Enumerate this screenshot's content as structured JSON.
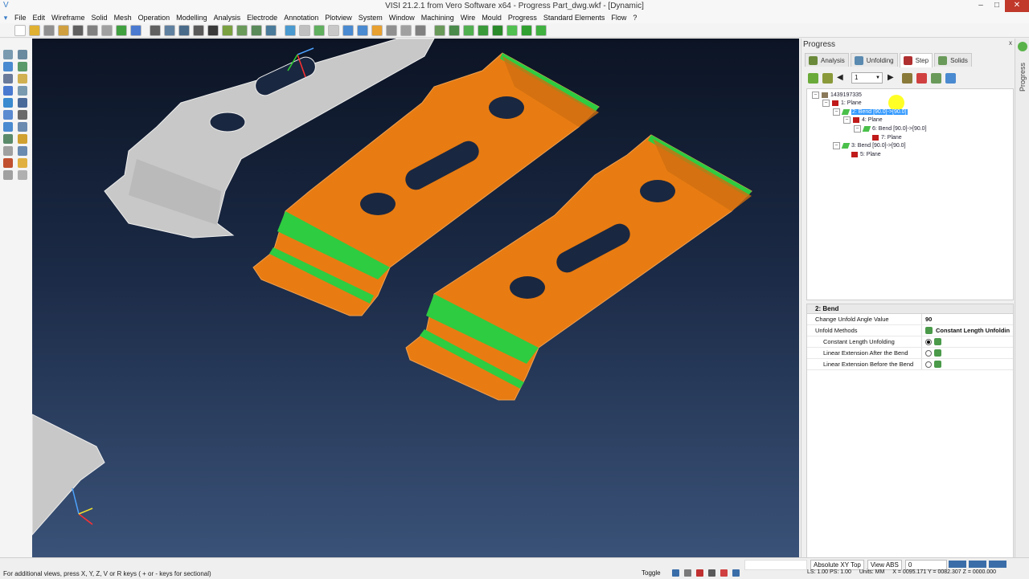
{
  "window": {
    "title": "VISI 21.2.1 from Vero Software x64 - Progress Part_dwg.wkf - [Dynamic]",
    "min_label": "–",
    "max_label": "□",
    "close_label": "✕"
  },
  "menu": [
    "File",
    "Edit",
    "Wireframe",
    "Solid",
    "Mesh",
    "Operation",
    "Modelling",
    "Analysis",
    "Electrode",
    "Annotation",
    "Plotview",
    "System",
    "Window",
    "Machining",
    "Wire",
    "Mould",
    "Progress",
    "Standard Elements",
    "Flow",
    "?"
  ],
  "colors": {
    "part_orange": "#e87c12",
    "bend_green": "#2ecc40",
    "part_gray": "#c8c8c8",
    "selection_blue": "#3399ff"
  },
  "panel": {
    "title": "Progress",
    "pin_label": " x",
    "tabs": [
      {
        "label": "Analysis",
        "icon": "analysis-icon",
        "active": false
      },
      {
        "label": "Unfolding",
        "icon": "unfolding-icon",
        "active": false
      },
      {
        "label": "Step",
        "icon": "step-icon",
        "active": true
      },
      {
        "label": "Solids",
        "icon": "solids-icon",
        "active": false
      }
    ],
    "step_value": "1",
    "tree": [
      {
        "label": "1439197335",
        "level": 0,
        "icon": "part-icon",
        "expander": "–"
      },
      {
        "label": "1: Plane",
        "level": 1,
        "icon": "plane-icon",
        "expander": "–"
      },
      {
        "label": "2: Bend [90.0]->[90.0]",
        "level": 2,
        "icon": "bend-icon",
        "expander": "–",
        "selected": true
      },
      {
        "label": "4: Plane",
        "level": 3,
        "icon": "plane-icon",
        "expander": "–"
      },
      {
        "label": "6: Bend [90.0]->[90.0]",
        "level": 4,
        "icon": "bend-icon",
        "expander": "–"
      },
      {
        "label": "7: Plane",
        "level": 5,
        "icon": "plane-icon",
        "expander": ""
      },
      {
        "label": "3: Bend [90.0]->[90.0]",
        "level": 2,
        "icon": "bend-icon",
        "expander": "–"
      },
      {
        "label": "5: Plane",
        "level": 3,
        "icon": "plane-icon",
        "expander": ""
      }
    ],
    "props": {
      "header": "2: Bend",
      "change_angle_label": "Change Unfold Angle Value",
      "change_angle_value": "90",
      "methods_label": "Unfold Methods",
      "methods_value": "Constant Length Unfoldin",
      "options": [
        {
          "label": "Constant Length Unfolding",
          "checked": true
        },
        {
          "label": "Linear Extension After the Bend",
          "checked": false
        },
        {
          "label": "Linear Extension Before the Bend",
          "checked": false
        }
      ]
    },
    "side_label": "Progress"
  },
  "status": {
    "hint": "For additional views, press X, Y, Z, V or R keys ( + or - keys for sectional)",
    "view_mode": "Absolute XY Top",
    "view_abs": "View ABS",
    "view_num": "0",
    "toggle": "Toggle",
    "ls": "LS: 1.00 PS: 1.00",
    "units": "Units: MM",
    "coords": "X = 0095.171 Y = 0082.307 Z = 0000.000"
  }
}
